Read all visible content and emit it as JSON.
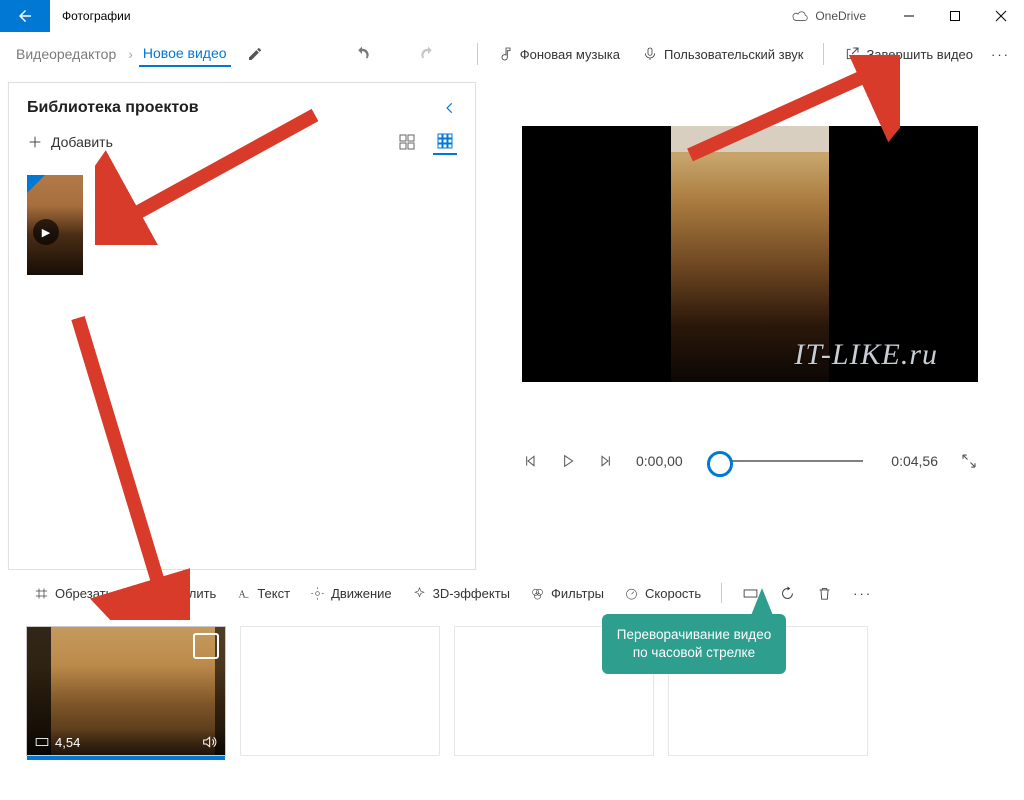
{
  "title_bar": {
    "app_name": "Фотографии",
    "onedrive_label": "OneDrive"
  },
  "toolbar": {
    "crumb_editor": "Видеоредактор",
    "crumb_new_video": "Новое видео",
    "bg_music": "Фоновая музыка",
    "custom_audio": "Пользовательский звук",
    "finish_video": "Завершить видео"
  },
  "library": {
    "title": "Библиотека проектов",
    "add_label": "Добавить"
  },
  "player": {
    "watermark": "IT-LIKE.ru",
    "time_current": "0:00,00",
    "time_total": "0:04,56"
  },
  "clip_toolbar": {
    "trim": "Обрезать",
    "split": "Разделить",
    "text": "Текст",
    "motion": "Движение",
    "effects_3d": "3D-эффекты",
    "filters": "Фильтры",
    "speed": "Скорость"
  },
  "storyboard": {
    "clip_duration": "4,54"
  },
  "annotation": {
    "rotate_hint": "Переворачивание видео по часовой стрелке"
  }
}
